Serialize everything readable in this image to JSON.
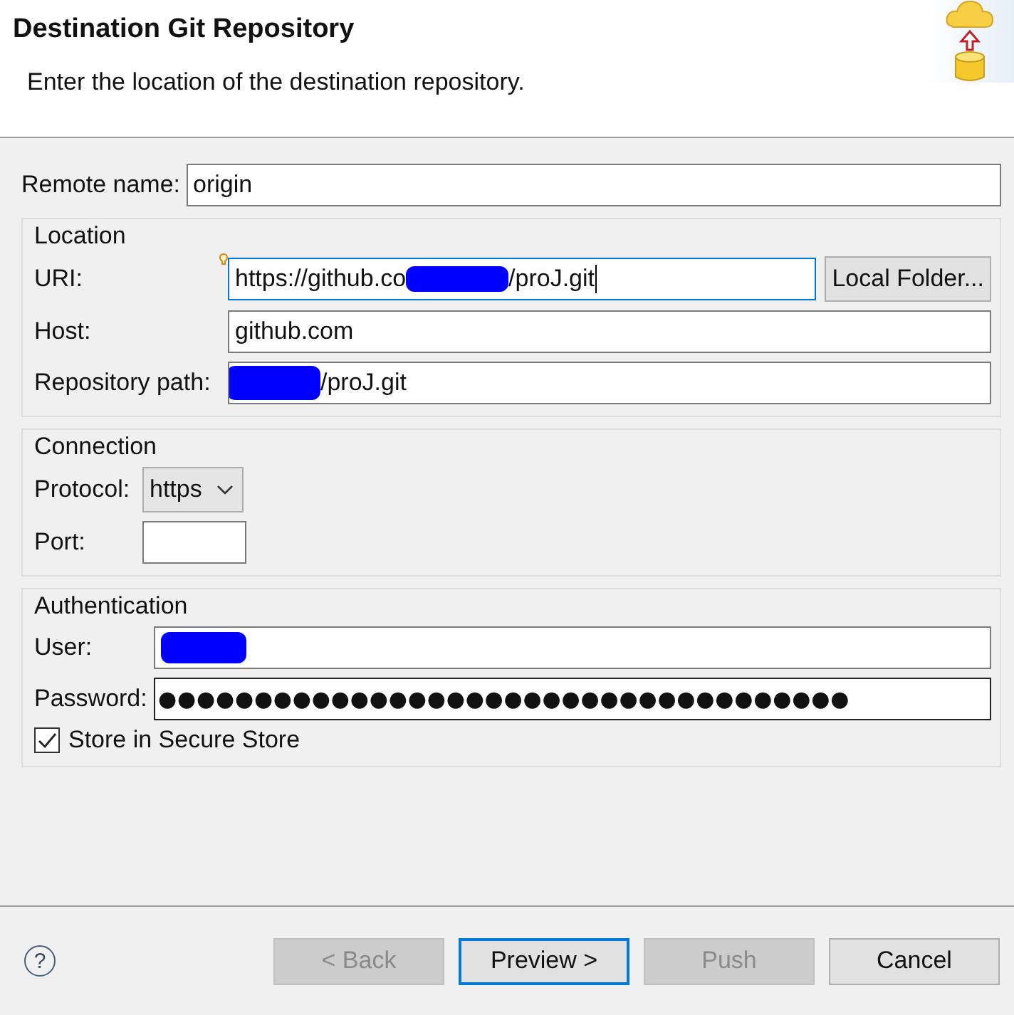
{
  "header": {
    "title": "Destination Git Repository",
    "description": "Enter the location of the destination repository."
  },
  "remote_name": {
    "label": "Remote name:",
    "value": "origin"
  },
  "location": {
    "title": "Location",
    "uri": {
      "label": "URI:",
      "value_start": "https://github.co",
      "value_end": "/proJ.git",
      "focused": true
    },
    "local_folder_button": "Local Folder...",
    "host": {
      "label": "Host:",
      "value": "github.com"
    },
    "repository_path": {
      "label": "Repository path:",
      "value": "/proJ.git"
    }
  },
  "connection": {
    "title": "Connection",
    "protocol": {
      "label": "Protocol:",
      "value": "https"
    },
    "port": {
      "label": "Port:"
    }
  },
  "authentication": {
    "title": "Authentication",
    "user": {
      "label": "User:"
    },
    "password": {
      "label": "Password:",
      "value": "●●●●●●●●●●●●●●●●●●●●●●●●●●●●●●●●●●●●"
    },
    "store": {
      "label": "Store in Secure Store",
      "checked": true
    }
  },
  "help": "?",
  "buttons": [
    {
      "label": "< Back",
      "disabled": true,
      "default": false
    },
    {
      "label": "Preview >",
      "disabled": false,
      "default": true
    },
    {
      "label": "Push",
      "disabled": true,
      "default": false
    },
    {
      "label": "Cancel",
      "disabled": false,
      "default": false
    }
  ]
}
